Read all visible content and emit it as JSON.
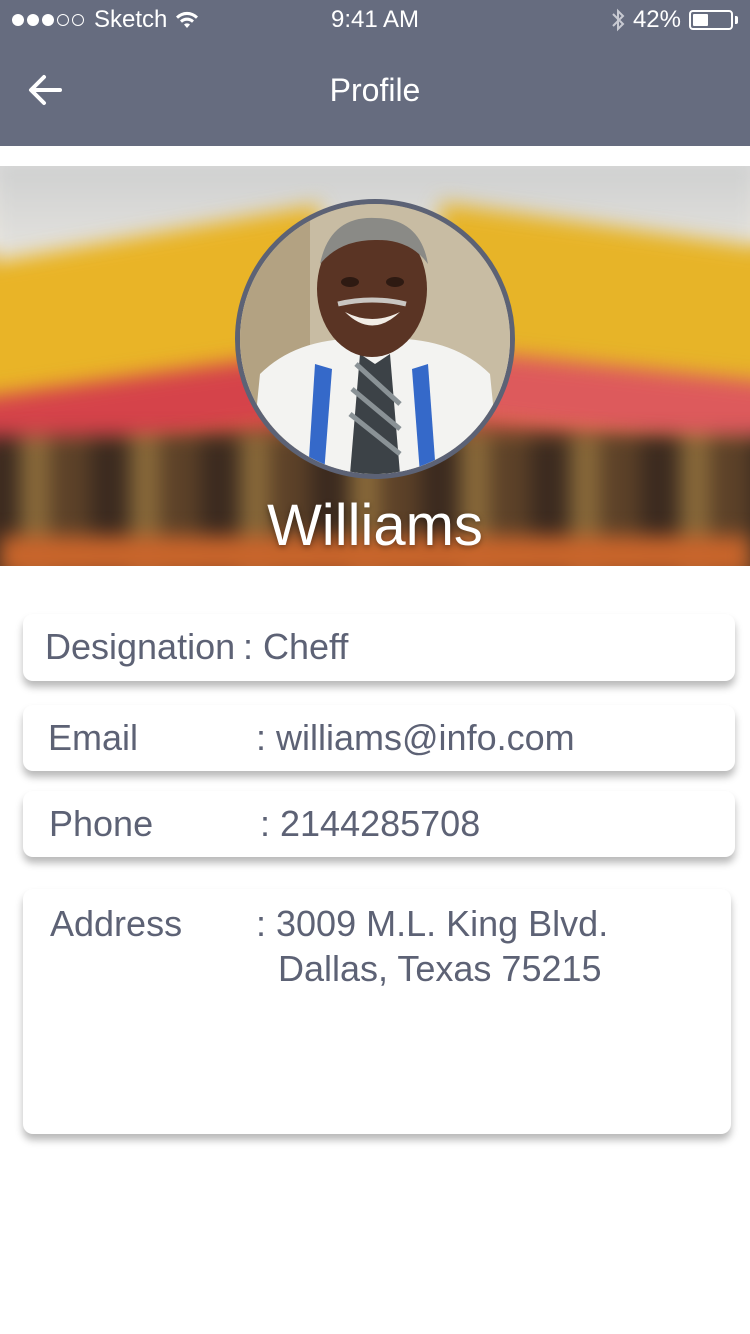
{
  "status_bar": {
    "carrier": "Sketch",
    "time": "9:41 AM",
    "battery_percent": "42%",
    "battery_level": 0.42,
    "signal_bars_filled": 3,
    "signal_bars_total": 5
  },
  "nav": {
    "title": "Profile",
    "back_icon": "arrow-left-icon"
  },
  "profile": {
    "name": "Williams"
  },
  "fields": {
    "designation": {
      "label": "Designation",
      "value": ": Cheff"
    },
    "email": {
      "label": "Email",
      "value": ": williams@info.com"
    },
    "phone": {
      "label": "Phone",
      "value": ": 2144285708"
    },
    "address": {
      "label": "Address",
      "value_line1": ": 3009 M.L. King Blvd.",
      "value_line2": "Dallas, Texas 75215"
    }
  },
  "colors": {
    "header": "#666c7f",
    "text": "#5d6275",
    "avatar_border": "#5c6275"
  }
}
